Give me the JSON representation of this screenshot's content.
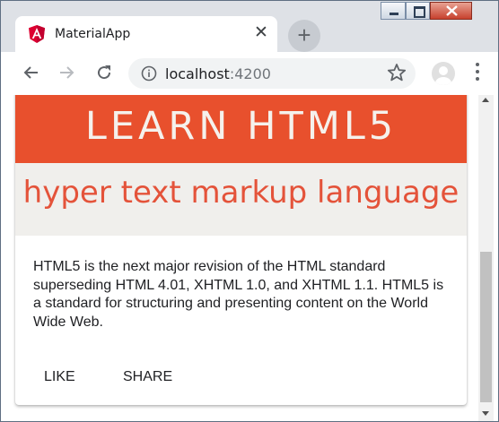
{
  "browser": {
    "tab_title": "MaterialApp",
    "tab_close_glyph": "✕",
    "new_tab_glyph": "+",
    "url_host": "localhost",
    "url_port": ":4200"
  },
  "card": {
    "image_line1": "LEARN HTML5",
    "image_line2": "hyper text markup language",
    "content": "HTML5 is the next major revision of the HTML standard superseding HTML 4.01, XHTML 1.0, and XHTML 1.1. HTML5 is a standard for structuring and presenting content on the World Wide Web.",
    "actions": [
      "LIKE",
      "SHARE"
    ]
  },
  "icons": {
    "tab_logo": "angular-icon",
    "back": "back-arrow-icon",
    "forward": "forward-arrow-icon",
    "reload": "reload-icon",
    "info": "info-icon",
    "bookmark": "star-icon",
    "profile": "profile-avatar-icon",
    "menu": "kebab-menu-icon"
  },
  "colors": {
    "banner_orange": "#e8502d",
    "banner_text_red": "#e4533a",
    "chrome_frame": "#dee1e6"
  }
}
